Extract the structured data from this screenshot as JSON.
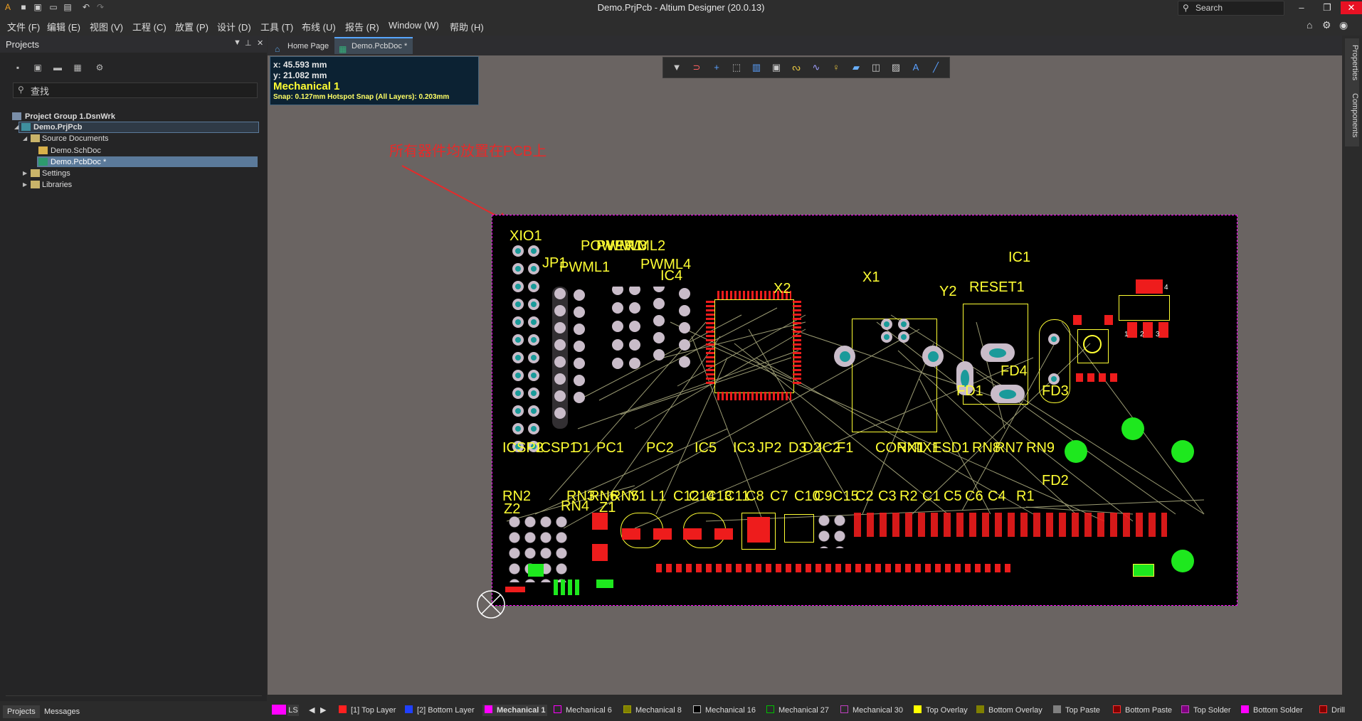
{
  "window": {
    "title": "Demo.PrjPcb - Altium Designer (20.0.13)",
    "search_placeholder": "Search"
  },
  "menu": [
    "文件 (F)",
    "编辑 (E)",
    "视图 (V)",
    "工程 (C)",
    "放置 (P)",
    "设计 (D)",
    "工具 (T)",
    "布线 (U)",
    "报告 (R)",
    "Window (W)",
    "帮助 (H)"
  ],
  "projects": {
    "title": "Projects",
    "search_value": "查找",
    "tree": [
      {
        "label": "Project Group 1.DsnWrk"
      },
      {
        "label": "Demo.PrjPcb"
      },
      {
        "label": "Source Documents"
      },
      {
        "label": "Demo.SchDoc"
      },
      {
        "label": "Demo.PcbDoc *"
      },
      {
        "label": "Settings"
      },
      {
        "label": "Libraries"
      }
    ],
    "bottom_tabs": [
      "Projects",
      "Messages"
    ]
  },
  "doc_tabs": [
    "Home Page",
    "Demo.PcbDoc *"
  ],
  "info": {
    "x": "x: 45.593 mm",
    "y": "y: 21.082 mm",
    "layer": "Mechanical 1",
    "snap": "Snap: 0.127mm Hotspot Snap (All Layers): 0.203mm"
  },
  "annotation": "所有器件均放置在PCB上",
  "right_tabs": [
    "Properties",
    "Components"
  ],
  "layer_bar": {
    "ls": "LS",
    "layers": [
      {
        "name": "[1] Top Layer",
        "color": "#ff2020"
      },
      {
        "name": "[2] Bottom Layer",
        "color": "#2040ff"
      },
      {
        "name": "Mechanical 1",
        "color": "#ff00ff"
      },
      {
        "name": "Mechanical 6",
        "color": "#ff00ff"
      },
      {
        "name": "Mechanical 8",
        "color": "#a0a000"
      },
      {
        "name": "Mechanical 16",
        "color": "#000000"
      },
      {
        "name": "Mechanical 27",
        "color": "#00a000"
      },
      {
        "name": "Mechanical 30",
        "color": "#c040c0"
      },
      {
        "name": "Top Overlay",
        "color": "#ffff00"
      },
      {
        "name": "Bottom Overlay",
        "color": "#808000"
      },
      {
        "name": "Top Paste",
        "color": "#808080"
      },
      {
        "name": "Bottom Paste",
        "color": "#800000"
      },
      {
        "name": "Top Solder",
        "color": "#800080"
      },
      {
        "name": "Bottom Solder",
        "color": "#ff00ff"
      },
      {
        "name": "Drill",
        "color": "#800000"
      }
    ]
  },
  "pcb_labels": [
    "XIO1",
    "JP1",
    "PWML1",
    "POWER1",
    "PWML3",
    "PWML2",
    "PWML4",
    "IC4",
    "X2",
    "X1",
    "Y2",
    "RESET1",
    "IC1",
    "FD4",
    "FD1",
    "FD3",
    "FD2",
    "ICSP2",
    "ICSP1",
    "D1",
    "PC1",
    "PC2",
    "IC5",
    "IC3",
    "JP2",
    "D3",
    "D2",
    "IC2",
    "F1",
    "CONN1",
    "RX1",
    "TX1",
    "ESD1",
    "RN8",
    "RN7",
    "RN9",
    "RN2",
    "RN3",
    "RN6",
    "RN5",
    "Y1",
    "L1",
    "C12",
    "C14",
    "C13",
    "C11",
    "C8",
    "C7",
    "C10",
    "C9",
    "C15",
    "C2",
    "C3",
    "R2",
    "C1",
    "C5",
    "C6",
    "C4",
    "R1",
    "Z2",
    "RN4",
    "Z1",
    "1",
    "2",
    "3",
    "4"
  ]
}
